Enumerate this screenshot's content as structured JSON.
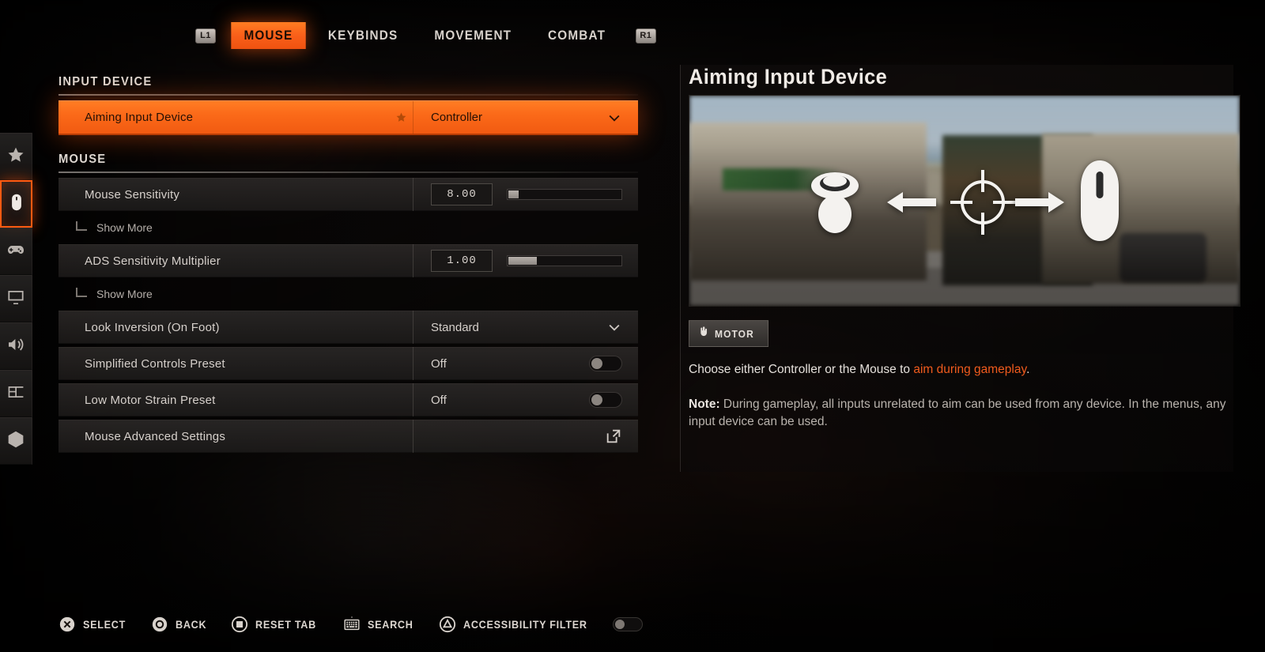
{
  "tabbar": {
    "left_bumper": "L1",
    "right_bumper": "R1",
    "tabs": [
      {
        "label": "MOUSE",
        "active": true
      },
      {
        "label": "KEYBINDS",
        "active": false
      },
      {
        "label": "MOVEMENT",
        "active": false
      },
      {
        "label": "COMBAT",
        "active": false
      }
    ]
  },
  "sidebar": {
    "items": [
      {
        "name": "favorites",
        "icon": "star-icon",
        "active": false
      },
      {
        "name": "controls",
        "icon": "mouse-icon",
        "active": true
      },
      {
        "name": "gameplay",
        "icon": "gamepad-icon",
        "active": false
      },
      {
        "name": "graphics",
        "icon": "monitor-icon",
        "active": false
      },
      {
        "name": "audio",
        "icon": "speaker-icon",
        "active": false
      },
      {
        "name": "interface",
        "icon": "layout-icon",
        "active": false
      },
      {
        "name": "accessibility",
        "icon": "accessibility-icon",
        "active": false
      }
    ]
  },
  "sections": [
    {
      "heading": "INPUT DEVICE",
      "rows": [
        {
          "label": "Aiming Input Device",
          "value": "Controller",
          "type": "dropdown",
          "highlighted": true,
          "favorited": true
        }
      ]
    },
    {
      "heading": "MOUSE",
      "rows": [
        {
          "label": "Mouse Sensitivity",
          "value": "8.00",
          "type": "slider",
          "fill_percent": 9,
          "show_more": "Show More"
        },
        {
          "label": "ADS Sensitivity Multiplier",
          "value": "1.00",
          "type": "slider",
          "fill_percent": 25,
          "show_more": "Show More"
        },
        {
          "label": "Look Inversion (On Foot)",
          "value": "Standard",
          "type": "dropdown"
        },
        {
          "label": "Simplified Controls Preset",
          "value": "Off",
          "type": "toggle",
          "enabled": false
        },
        {
          "label": "Low Motor Strain Preset",
          "value": "Off",
          "type": "toggle",
          "enabled": false
        },
        {
          "label": "Mouse Advanced Settings",
          "value": "",
          "type": "link"
        }
      ]
    }
  ],
  "info": {
    "title": "Aiming Input Device",
    "tag": "MOTOR",
    "tag_icon": "hand-icon",
    "description_before": "Choose either Controller or the Mouse to ",
    "description_accent": "aim during gameplay",
    "description_after": ".",
    "note_label": "Note:",
    "note_text": " During gameplay, all inputs unrelated to aim can be used from any device. In the menus, any input device can be used.",
    "preview_icons": [
      "thumbstick-icon",
      "arrow-left-icon",
      "crosshair-icon",
      "arrow-right-icon",
      "mouse-icon"
    ]
  },
  "actions": [
    {
      "label": "SELECT",
      "icon": "playstation-cross-icon"
    },
    {
      "label": "BACK",
      "icon": "playstation-circle-icon"
    },
    {
      "label": "RESET TAB",
      "icon": "playstation-square-icon"
    },
    {
      "label": "SEARCH",
      "icon": "keyboard-icon"
    },
    {
      "label": "ACCESSIBILITY FILTER",
      "icon": "playstation-triangle-icon",
      "toggle": false
    }
  ],
  "colors": {
    "accent": "#f05b1d",
    "highlight_start": "#ff7d24",
    "highlight_end": "#f15a11"
  }
}
